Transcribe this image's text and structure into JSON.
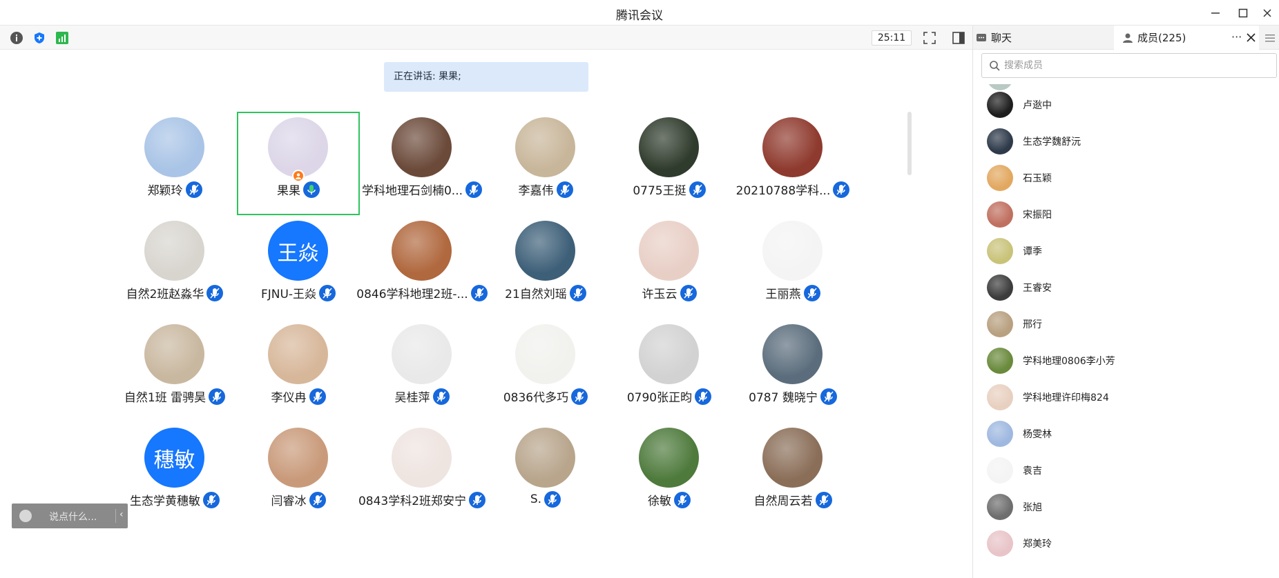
{
  "window": {
    "title": "腾讯会议"
  },
  "toolbar": {
    "timer": "25:11"
  },
  "main": {
    "speaking_text": "正在讲话: 果果;",
    "participants": [
      {
        "name": "郑颖玲",
        "avatar": "photo",
        "color": "#a9c4e6"
      },
      {
        "name": "果果",
        "avatar": "photo",
        "color": "#dcd6e8",
        "active": true,
        "host": true
      },
      {
        "name": "学科地理石剑楠0...",
        "avatar": "photo",
        "color": "#6b4a3a"
      },
      {
        "name": "李嘉伟",
        "avatar": "photo",
        "color": "#c8b69a"
      },
      {
        "name": "0775王挺",
        "avatar": "photo",
        "color": "#2f3b2c"
      },
      {
        "name": "20210788学科...",
        "avatar": "photo",
        "color": "#8f3a2e"
      },
      {
        "name": "自然2班赵淼华",
        "avatar": "photo",
        "color": "#d8d5cf"
      },
      {
        "name": "FJNU-王焱",
        "avatar": "text",
        "text": "王焱"
      },
      {
        "name": "0846学科地理2班-...",
        "avatar": "photo",
        "color": "#b0683e"
      },
      {
        "name": "21自然刘瑶",
        "avatar": "photo",
        "color": "#3d5f78"
      },
      {
        "name": "许玉云",
        "avatar": "photo",
        "color": "#e8cfc6"
      },
      {
        "name": "王丽燕",
        "avatar": "photo",
        "color": "#f4f4f4"
      },
      {
        "name": "自然1班 雷骋昊",
        "avatar": "photo",
        "color": "#c9b8a0"
      },
      {
        "name": "李仪冉",
        "avatar": "photo",
        "color": "#d7b79a"
      },
      {
        "name": "吴桂萍",
        "avatar": "photo",
        "color": "#e9e9e9"
      },
      {
        "name": "0836代多巧",
        "avatar": "photo",
        "color": "#f1f1ee"
      },
      {
        "name": "0790张正昀",
        "avatar": "photo",
        "color": "#d2d2d2"
      },
      {
        "name": "0787 魏晓宁",
        "avatar": "photo",
        "color": "#5b6d7c"
      },
      {
        "name": "生态学黄穗敏",
        "avatar": "text",
        "text": "穗敏"
      },
      {
        "name": "闫睿冰",
        "avatar": "photo",
        "color": "#c99a7a"
      },
      {
        "name": "0843学科2班郑安宁",
        "avatar": "photo",
        "color": "#eee4e0"
      },
      {
        "name": "S.",
        "avatar": "photo",
        "color": "#b8a58c"
      },
      {
        "name": "徐敏",
        "avatar": "photo",
        "color": "#4e7a3c"
      },
      {
        "name": "自然周云若",
        "avatar": "photo",
        "color": "#8a6e58"
      }
    ],
    "chat_placeholder": "说点什么..."
  },
  "side": {
    "chat_tab": "聊天",
    "members_tab": "成员(225)",
    "more_label": "···",
    "search_placeholder": "搜索成员",
    "members": [
      {
        "name": "卢逖中",
        "color": "#1e1e1e"
      },
      {
        "name": "生态学魏舒沅",
        "color": "#2e3a4a"
      },
      {
        "name": "石玉颖",
        "color": "#e2a860"
      },
      {
        "name": "宋振阳",
        "color": "#c07060"
      },
      {
        "name": "谭季",
        "color": "#c9c37a"
      },
      {
        "name": "王睿安",
        "color": "#3c3c3c"
      },
      {
        "name": "邢行",
        "color": "#b8a080"
      },
      {
        "name": "学科地理0806李小芳",
        "color": "#6a8a3c"
      },
      {
        "name": "学科地理许印梅824",
        "color": "#e8d0c0"
      },
      {
        "name": "杨雯林",
        "color": "#9fb8e0"
      },
      {
        "name": "袁吉",
        "color": "#f4f4f4"
      },
      {
        "name": "张旭",
        "color": "#6e6e6e"
      },
      {
        "name": "郑美玲",
        "color": "#e8c4c8"
      }
    ]
  },
  "colors": {
    "accent": "#1677ff",
    "active_border": "#2ec45c",
    "speaking_bg": "#dbe9fb"
  }
}
